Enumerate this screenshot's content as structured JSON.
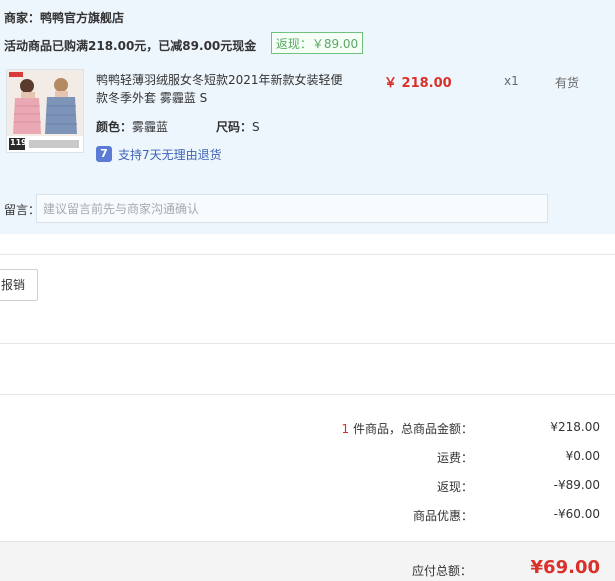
{
  "shop": {
    "label": "商家：",
    "name": "鸭鸭官方旗舰店"
  },
  "promo": {
    "text": "活动商品已购满218.00元，已减89.00元现金",
    "cashback": "返现：￥89.00"
  },
  "item": {
    "thumb_badge": "119",
    "title": "鸭鸭轻薄羽绒服女冬短款2021年新款女装轻便款冬季外套 雾霾蓝 S",
    "price": "￥ 218.00",
    "qty": "x1",
    "stock": "有货",
    "color_label": "颜色：",
    "color_value": "雾霾蓝",
    "size_label": "尺码：",
    "size_value": "S",
    "return_badge": "7",
    "return_text": "支持7天无理由退货"
  },
  "message": {
    "label": "留言：",
    "placeholder": "建议留言前先与商家沟通确认"
  },
  "reimburse_button": "报销",
  "summary": {
    "count": "1",
    "count_suffix": " 件商品，总商品金额：",
    "goods_total": "¥218.00",
    "shipping_label": "运费：",
    "shipping": "¥0.00",
    "cashback_label": "返现：",
    "cashback": "-¥89.00",
    "discount_label": "商品优惠：",
    "discount": "-¥60.00"
  },
  "total": {
    "label": "应付总额：",
    "value": "¥69.00"
  },
  "colors": {
    "price_red": "#d9312a",
    "panel_bg": "#eef6fd",
    "cashback_green": "#5aa866",
    "link_blue": "#3e63b6"
  }
}
